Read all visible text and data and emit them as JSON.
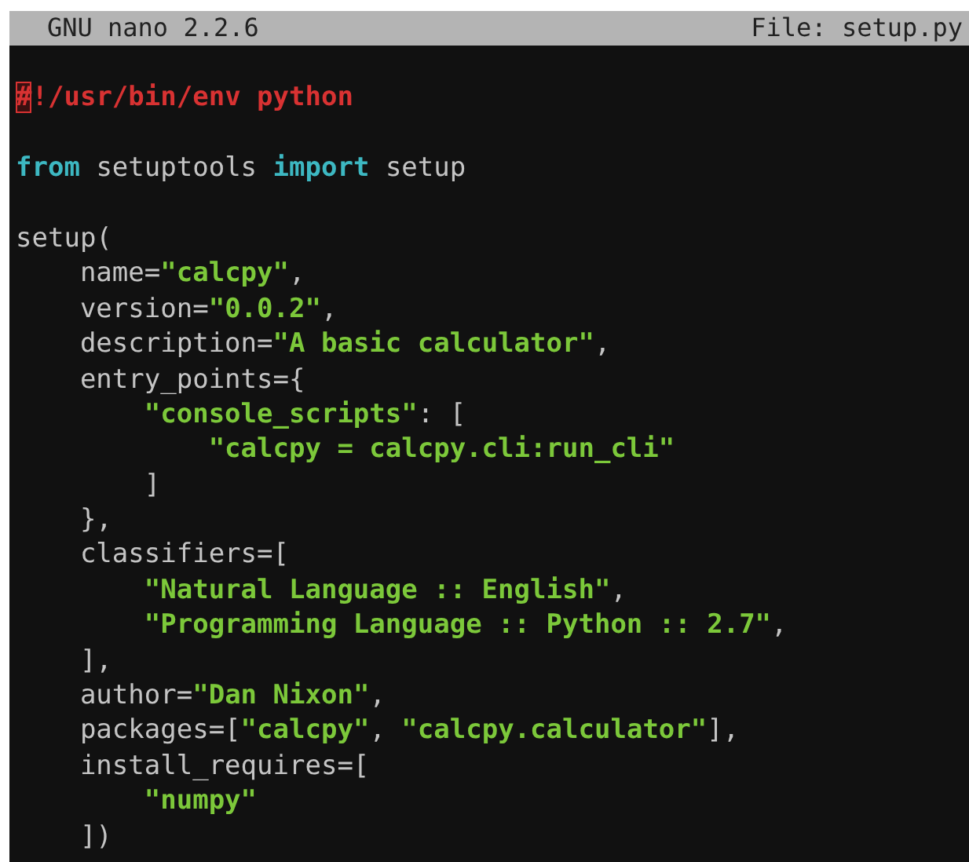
{
  "title_bar": {
    "app": "GNU nano 2.2.6",
    "file": "File: setup.py"
  },
  "lines": [
    {
      "kind": "blank"
    },
    {
      "kind": "code",
      "tokens": [
        {
          "kind": "comment",
          "text": "#",
          "cursor": true
        },
        {
          "kind": "comment",
          "text": "!/usr/bin/env python"
        }
      ]
    },
    {
      "kind": "blank"
    },
    {
      "kind": "code",
      "tokens": [
        {
          "kind": "keyword",
          "text": "from"
        },
        {
          "kind": "plain",
          "text": " setuptools "
        },
        {
          "kind": "keyword",
          "text": "import"
        },
        {
          "kind": "plain",
          "text": " setup"
        }
      ]
    },
    {
      "kind": "blank"
    },
    {
      "kind": "code",
      "tokens": [
        {
          "kind": "plain",
          "text": "setup("
        }
      ]
    },
    {
      "kind": "code",
      "tokens": [
        {
          "kind": "plain",
          "text": "    name="
        },
        {
          "kind": "string",
          "text": "\"calcpy\""
        },
        {
          "kind": "plain",
          "text": ","
        }
      ]
    },
    {
      "kind": "code",
      "tokens": [
        {
          "kind": "plain",
          "text": "    version="
        },
        {
          "kind": "string",
          "text": "\"0.0.2\""
        },
        {
          "kind": "plain",
          "text": ","
        }
      ]
    },
    {
      "kind": "code",
      "tokens": [
        {
          "kind": "plain",
          "text": "    description="
        },
        {
          "kind": "string",
          "text": "\"A basic calculator\""
        },
        {
          "kind": "plain",
          "text": ","
        }
      ]
    },
    {
      "kind": "code",
      "tokens": [
        {
          "kind": "plain",
          "text": "    entry_points={"
        }
      ]
    },
    {
      "kind": "code",
      "tokens": [
        {
          "kind": "string",
          "text": "        \"console_scripts\""
        },
        {
          "kind": "plain",
          "text": ": ["
        }
      ]
    },
    {
      "kind": "code",
      "tokens": [
        {
          "kind": "string",
          "text": "            \"calcpy = calcpy.cli:run_cli\""
        }
      ]
    },
    {
      "kind": "code",
      "tokens": [
        {
          "kind": "plain",
          "text": "        ]"
        }
      ]
    },
    {
      "kind": "code",
      "tokens": [
        {
          "kind": "plain",
          "text": "    },"
        }
      ]
    },
    {
      "kind": "code",
      "tokens": [
        {
          "kind": "plain",
          "text": "    classifiers=["
        }
      ]
    },
    {
      "kind": "code",
      "tokens": [
        {
          "kind": "string",
          "text": "        \"Natural Language :: English\""
        },
        {
          "kind": "plain",
          "text": ","
        }
      ]
    },
    {
      "kind": "code",
      "tokens": [
        {
          "kind": "string",
          "text": "        \"Programming Language :: Python :: 2.7\""
        },
        {
          "kind": "plain",
          "text": ","
        }
      ]
    },
    {
      "kind": "code",
      "tokens": [
        {
          "kind": "plain",
          "text": "    ],"
        }
      ]
    },
    {
      "kind": "code",
      "tokens": [
        {
          "kind": "plain",
          "text": "    author="
        },
        {
          "kind": "string",
          "text": "\"Dan Nixon\""
        },
        {
          "kind": "plain",
          "text": ","
        }
      ]
    },
    {
      "kind": "code",
      "tokens": [
        {
          "kind": "plain",
          "text": "    packages=["
        },
        {
          "kind": "string",
          "text": "\"calcpy\""
        },
        {
          "kind": "plain",
          "text": ", "
        },
        {
          "kind": "string",
          "text": "\"calcpy.calculator\""
        },
        {
          "kind": "plain",
          "text": "],"
        }
      ]
    },
    {
      "kind": "code",
      "tokens": [
        {
          "kind": "plain",
          "text": "    install_requires=["
        }
      ]
    },
    {
      "kind": "code",
      "tokens": [
        {
          "kind": "string",
          "text": "        \"numpy\""
        }
      ]
    },
    {
      "kind": "code",
      "tokens": [
        {
          "kind": "plain",
          "text": "    ])"
        }
      ]
    }
  ]
}
